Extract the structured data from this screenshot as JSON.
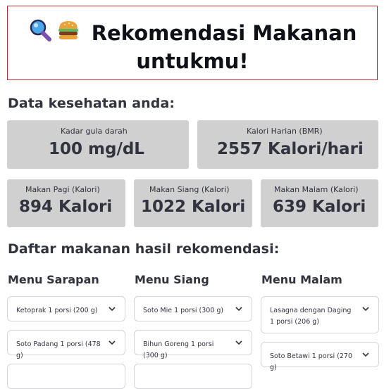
{
  "banner": {
    "title": "Rekomendasi Makanan untukmu!",
    "icons": [
      "magnifying-glass-icon",
      "burger-icon"
    ]
  },
  "health_heading": "Data kesehatan anda:",
  "metrics": {
    "blood_sugar": {
      "label": "Kadar gula darah",
      "value": "100 mg/dL"
    },
    "bmr": {
      "label": "Kalori Harian (BMR)",
      "value": "2557 Kalori/hari"
    },
    "breakfast": {
      "label": "Makan Pagi (Kalori)",
      "value": "894 Kalori"
    },
    "lunch": {
      "label": "Makan Siang (Kalori)",
      "value": "1022 Kalori"
    },
    "dinner": {
      "label": "Makan Malam (Kalori)",
      "value": "639 Kalori"
    }
  },
  "list_heading": "Daftar makanan hasil rekomendasi:",
  "menus": {
    "breakfast": {
      "title": "Menu Sarapan",
      "items": [
        "Ketoprak 1 porsi (200 g)",
        "Soto Padang 1 porsi (478 g)"
      ]
    },
    "lunch": {
      "title": "Menu Siang",
      "items": [
        "Soto Mie 1 porsi (300 g)",
        "Bihun Goreng 1 porsi (300 g)"
      ]
    },
    "dinner": {
      "title": "Menu Malam",
      "items": [
        "Lasagna dengan Daging 1 porsi (206 g)",
        "Soto Betawi 1 porsi (270 g)"
      ]
    }
  },
  "colors": {
    "banner_border": "#c0282e",
    "metric_bg": "#d0d0d0",
    "text": "#31333f"
  }
}
